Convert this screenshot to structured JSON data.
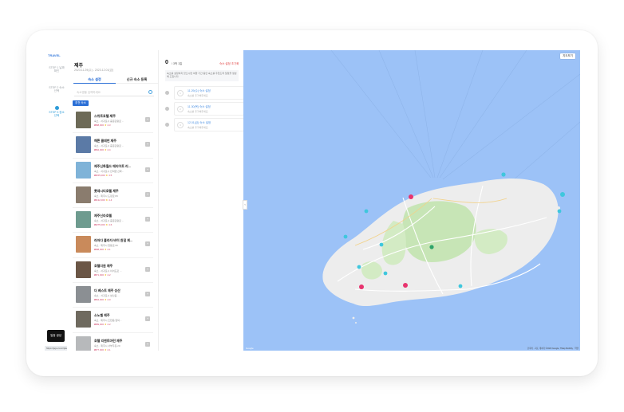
{
  "rail": {
    "logo": "TRAVEL",
    "items": [
      {
        "label": "STEP 1 날짜 확인",
        "active": false
      },
      {
        "label": "STEP 2 숙소 선택",
        "active": false
      },
      {
        "label": "STEP 3 장소 선택",
        "active": true
      }
    ],
    "saved_button": "일정 생성",
    "status_url": "https://jeju.co.kr/plan/region/jeju?step=3"
  },
  "list": {
    "city": "제주",
    "dates": "2023.11.29(수) - 2023.12.01(금)",
    "tabs": [
      {
        "label": "숙소 설정",
        "active": true
      },
      {
        "label": "신규 숙소 등록",
        "active": false
      }
    ],
    "search_placeholder": "숙소명을 입력하세요",
    "filter_chip": "추천 숙소",
    "cards": [
      {
        "title": "스위트호텔 제주",
        "address": "숙소 · 서귀포시 중문관광로 ...",
        "price": "₩68,000",
        "rating": "4.3",
        "thumb": "#6d6a57"
      },
      {
        "title": "해튼 클래번 제주",
        "address": "숙소 · 서귀포시 중문관광로 ...",
        "price": "₩62,000",
        "rating": "4.4",
        "thumb": "#5b7aa6"
      },
      {
        "title": "제주신화월드 메리어트 리...",
        "address": "숙소 · 서귀포시 안덕면 신화...",
        "price": "₩155,000",
        "rating": "4.5",
        "thumb": "#7fb3d8"
      },
      {
        "title": "롯데시티호텔 제주",
        "address": "숙소 · 제주시 도령로 83",
        "price": "₩132,000",
        "rating": "4.4",
        "thumb": "#8a7c6e"
      },
      {
        "title": "제주신라호텔",
        "address": "숙소 · 서귀포시 중문관광로 ...",
        "price": "₩275,000",
        "rating": "4.6",
        "thumb": "#6e9b8f"
      },
      {
        "title": "라마다 플라자 바이 윈덤 제...",
        "address": "숙소 · 제주시 탑동로 66",
        "price": "₩98,000",
        "rating": "4.1",
        "thumb": "#c98a5b"
      },
      {
        "title": "호텔더원 제주",
        "address": "숙소 · 서귀포시 이어도로 ...",
        "price": "₩71,000",
        "rating": "4.2",
        "thumb": "#6b5646"
      },
      {
        "title": "더 베스트 제주 성산",
        "address": "숙소 · 서귀포시 성산읍 ...",
        "price": "₩64,000",
        "rating": "4.0",
        "thumb": "#8b8f93"
      },
      {
        "title": "소노벨 제주",
        "address": "숙소 · 제주시 조천읍 함덕...",
        "price": "₩89,000",
        "rating": "4.2",
        "thumb": "#6f6a5f"
      },
      {
        "title": "호텔 리젠트마린 제주",
        "address": "숙소 · 제주시 서부두길 20",
        "price": "₩77,000",
        "rating": "4.1",
        "thumb": "#b7b9bb"
      }
    ]
  },
  "schedule": {
    "day_number": "0",
    "day_label": "/ 3박 1일",
    "reset_label": "숙소 설정 초기화",
    "notice": "숙소를 설정하지 않으시면 여행 기간 동안 숙소를 추천드려 일정을 생성해 드립니다.",
    "slots": [
      {
        "num": "1",
        "title": "11.29(수) 숙소 설정",
        "sub": "숙소를 추가해주세요"
      },
      {
        "num": "2",
        "title": "11.30(목) 숙소 설정",
        "sub": "숙소를 추가해주세요"
      },
      {
        "num": "3",
        "title": "12.01(금) 숙소 설정",
        "sub": "숙소를 추가해주세요"
      }
    ]
  },
  "map": {
    "view_button": "지도보기",
    "attribution": "단축키 · 지도 데이터 ©2023 Google, TMap Mobility · 약관",
    "provider": "Google",
    "colors": {
      "sea": "#9cc2f7",
      "land": "#ededed",
      "park": "#c7e5b6",
      "marker_pink": "#e8336e",
      "marker_cyan": "#3fc7dd"
    }
  }
}
